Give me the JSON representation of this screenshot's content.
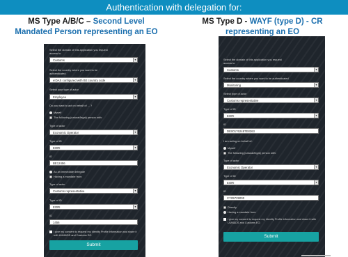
{
  "banner": "Authentication with delegation for:",
  "heading_left": {
    "line1_dark": "MS Type A/B/C – ",
    "line1_blue": "Second Level",
    "line2_blue": "Mandated Person representing an EO"
  },
  "heading_right": {
    "line1_dark": "MS Type D - ",
    "line1_blue": "WAYF (type D) - CR",
    "line2_blue": "representing an EO"
  },
  "colors": {
    "banner": "#0e8ec0",
    "heading_blue": "#1b6fae",
    "panel_bg": "#1f252c",
    "submit_button": "#17a2a2"
  },
  "left": {
    "q_domain": "Select the domain of this application you request",
    "q_domain2": "access to",
    "domain_value": "Customs",
    "q_country": "Select the country where you want to be",
    "q_country2": "authenticated",
    "country_value": "eIDAS configured with BE country code",
    "q_actor": "Select your type of actor",
    "actor_value": "Employee",
    "q_behalf": "Do you want to act on behalf of ... ?",
    "radio_myself": "Myself",
    "radio_following": "The following (natural/legal) person with:",
    "type_actor_label": "Type of actor",
    "type_actor_value": "Economic Operator",
    "type_id_label": "Type of ID",
    "type_id_value": "EORI",
    "id_label": "ID",
    "id_value": "BE12456",
    "radio_immediate": "As an immediate delegate",
    "radio_mandate": "Having a mandate from",
    "type_actor2_label": "Type of actor",
    "type_actor2_value": "Customs representative",
    "type_id2_label": "Type of ID",
    "type_id2_value": "EORI",
    "id2_label": "ID",
    "id2_value": "1456",
    "consent": "I give my consent to request my Identity Profile information and share it with UUM&DS and Customs EO.",
    "submit": "Submit"
  },
  "right": {
    "q_domain": "Select the domain of this application you request",
    "q_domain2": "access to",
    "domain_value": "Customs",
    "q_country": "Select the country where you want to be authenticated",
    "country_value": "Monitoring",
    "q_actor": "Select type of actor",
    "actor_value": "Customs representative",
    "type_id_label": "Type of ID",
    "type_id_value": "EORI",
    "id_label": "ID",
    "id_value": "DE001762487E8263",
    "behalf": "I am acting on behalf of:",
    "radio_myself": "Myself",
    "radio_following": "The following (natural/legal) person with:",
    "type_actor_label": "Type of actor",
    "type_actor_value": "Economic Operator",
    "type_id2_label": "Type of ID",
    "type_id2_value": "EORI",
    "id2_label": "ID",
    "id2_value": "CY05729000",
    "radio_directly": "Directly",
    "radio_mandate": "Having a mandate from",
    "consent": "I give my consent to request my Identity Profile information and share it with UUM&DS and Customs EO.",
    "submit": "Submit"
  }
}
